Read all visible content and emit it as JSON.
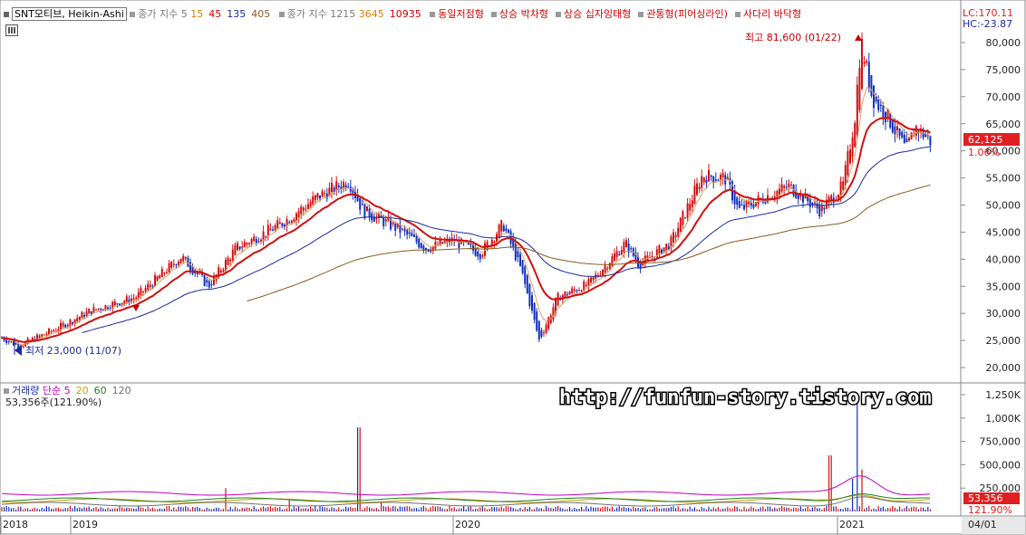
{
  "header": {
    "ticker": "SNT모티브, Heikin-Ashi",
    "ma_label": "종가 지수 5",
    "ma_values": [
      {
        "text": "15",
        "color": "#e08000"
      },
      {
        "text": "45",
        "color": "#cc0000"
      },
      {
        "text": "135",
        "color": "#1a2a9a"
      },
      {
        "text": "405",
        "color": "#8a5a20"
      }
    ],
    "ma2_label": "종가 지수 1215",
    "ma2_values": [
      {
        "text": "3645",
        "color": "#e08000"
      },
      {
        "text": "10935",
        "color": "#cc0000"
      }
    ],
    "patterns": [
      "동일저점형",
      "상승 박차형",
      "상승 십자잉태형",
      "관통형(피어싱라인)",
      "사다리 바닥형"
    ],
    "lc": "LC:170.11",
    "hc": "HC:-23.87"
  },
  "annotations": {
    "high": "최고 81,600 (01/22)",
    "low": "최저 23,000 (11/07)"
  },
  "price_axis": {
    "ticks": [
      "80,000",
      "75,000",
      "70,000",
      "65,000",
      "60,000",
      "55,000",
      "50,000",
      "45,000",
      "40,000",
      "35,000",
      "30,000",
      "25,000",
      "20,000"
    ],
    "current": "62,125",
    "change": "1.06%"
  },
  "volume_header": {
    "label": "거래량",
    "ma_label": "단순",
    "ma_values": [
      {
        "text": "5",
        "color": "#c000c0"
      },
      {
        "text": "20",
        "color": "#d0a000"
      },
      {
        "text": "60",
        "color": "#208020"
      },
      {
        "text": "120",
        "color": "#707070"
      }
    ],
    "current": "53,356주(121.90%)"
  },
  "volume_axis": {
    "ticks": [
      "1,250K",
      "1,000K",
      "750,000",
      "500,000",
      "250,000"
    ],
    "current": "53,356",
    "change": "121.90%"
  },
  "x_axis": {
    "labels": [
      "2018",
      "2019",
      "2020",
      "2021",
      "04/01"
    ]
  },
  "watermark": "http://funfun-story.tistory.com",
  "chart_data": {
    "type": "candlestick",
    "title": "SNT모티브, Heikin-Ashi",
    "ylim": [
      19000,
      84000
    ],
    "x": [
      "2018-11",
      "2019-01",
      "2019-03",
      "2019-05",
      "2019-07",
      "2019-09",
      "2019-11",
      "2020-01",
      "2020-03",
      "2020-05",
      "2020-07",
      "2020-09",
      "2020-11",
      "2021-01",
      "2021-02",
      "2021-03"
    ],
    "series": [
      {
        "name": "종가",
        "values": [
          24000,
          28000,
          33500,
          40000,
          36000,
          45000,
          53000,
          51000,
          44000,
          27000,
          40000,
          50000,
          53000,
          81600,
          66000,
          62125
        ]
      },
      {
        "name": "거래량",
        "values": [
          20000,
          30000,
          40000,
          60000,
          40000,
          60000,
          900000,
          60000,
          80000,
          90000,
          60000,
          70000,
          40000,
          1250000,
          200000,
          53356
        ]
      }
    ],
    "high": {
      "value": 81600,
      "date": "01/22"
    },
    "low": {
      "value": 23000,
      "date": "11/07"
    }
  }
}
